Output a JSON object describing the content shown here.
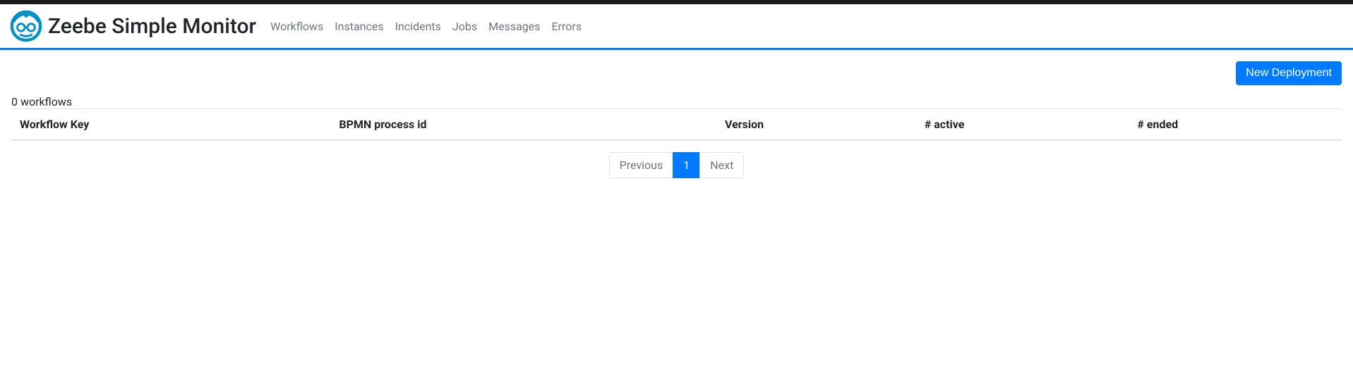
{
  "brand": "Zeebe Simple Monitor",
  "nav": {
    "workflows": "Workflows",
    "instances": "Instances",
    "incidents": "Incidents",
    "jobs": "Jobs",
    "messages": "Messages",
    "errors": "Errors"
  },
  "actions": {
    "new_deployment": "New Deployment"
  },
  "summary": {
    "count_label": "0 workflows"
  },
  "table": {
    "headers": {
      "workflow_key": "Workflow Key",
      "bpmn_process_id": "BPMN process id",
      "version": "Version",
      "active": "# active",
      "ended": "# ended"
    }
  },
  "pagination": {
    "previous": "Previous",
    "current": "1",
    "next": "Next"
  }
}
